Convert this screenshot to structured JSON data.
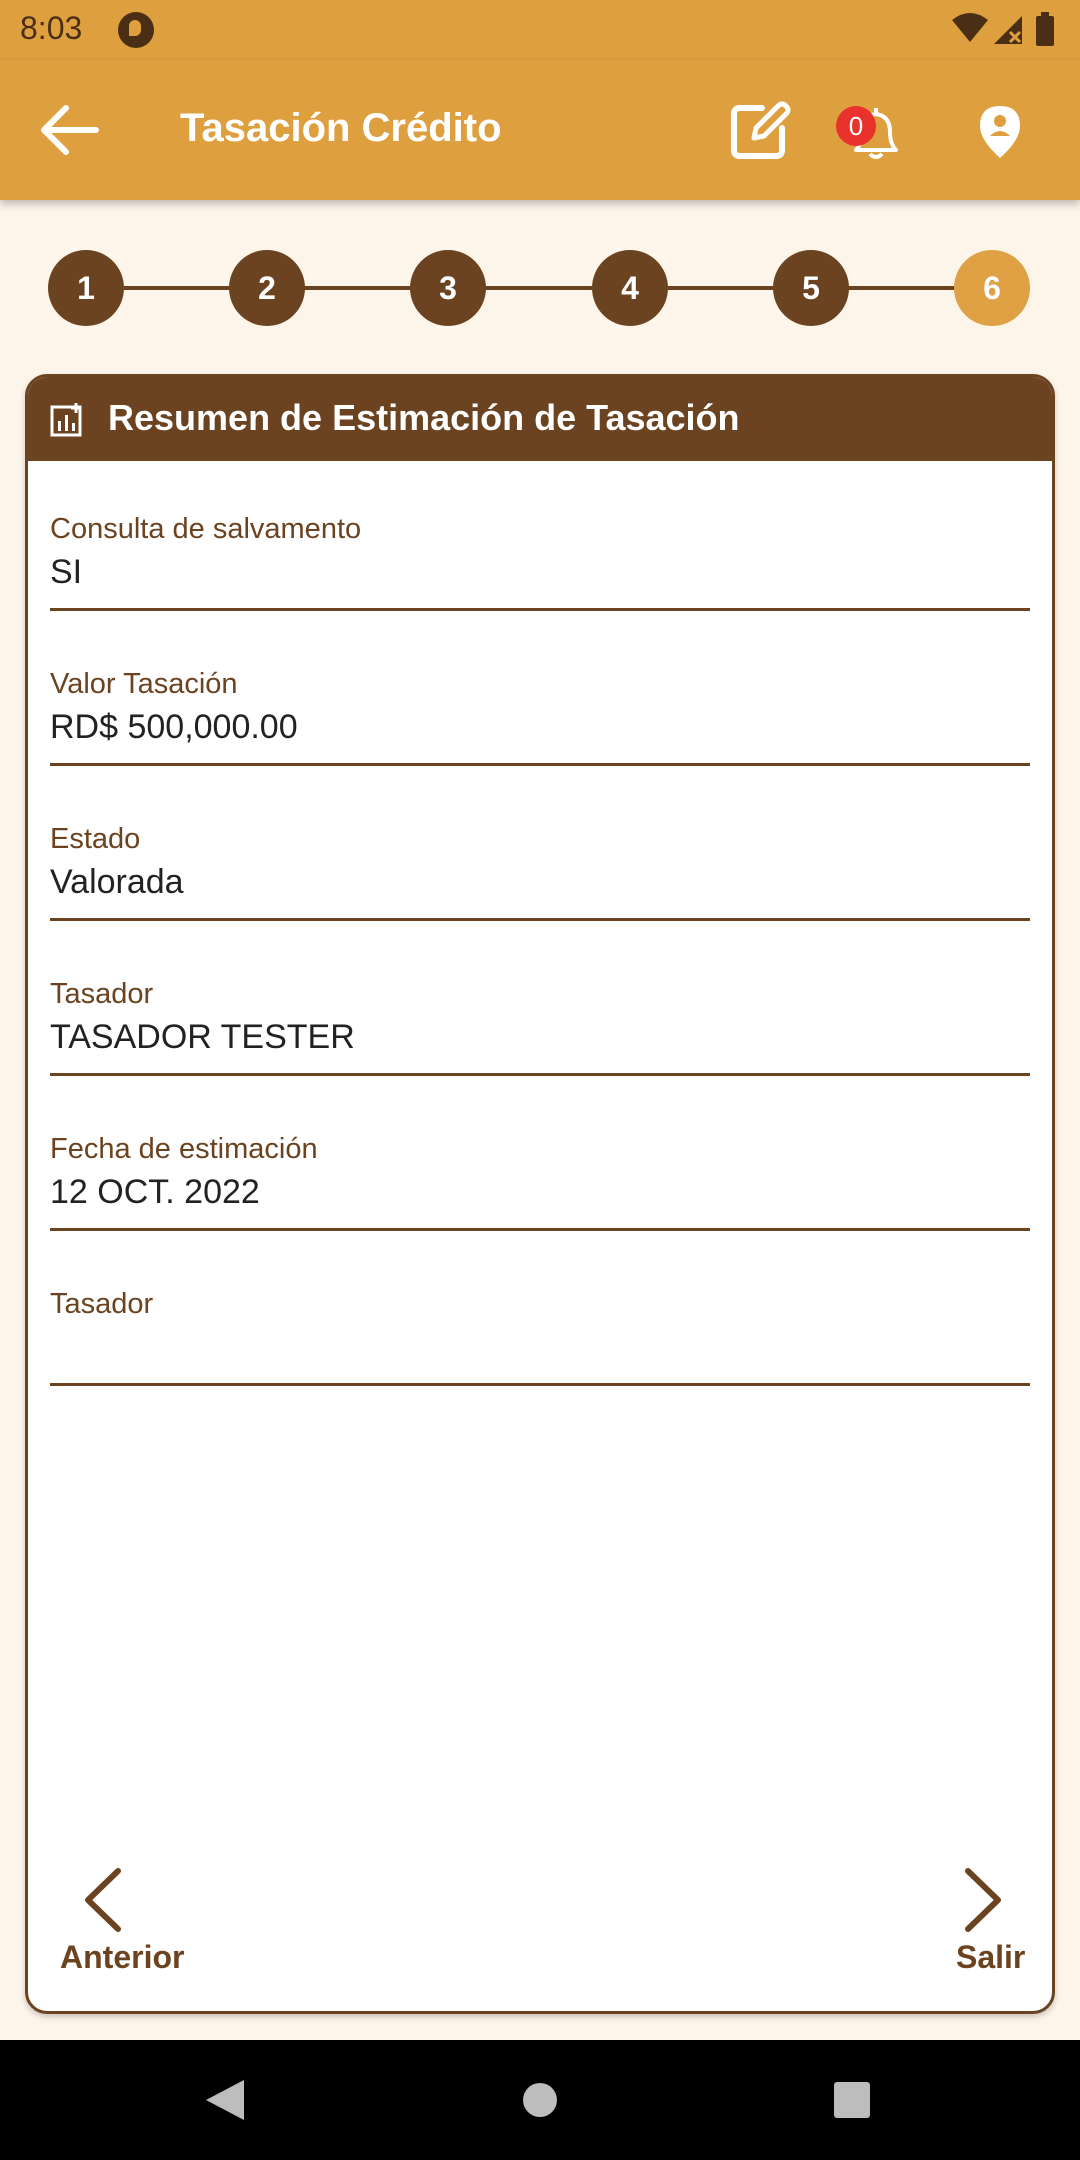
{
  "status_bar": {
    "time": "8:03"
  },
  "app_bar": {
    "title": "Tasación Crédito",
    "notification_count": "0"
  },
  "stepper": {
    "steps": [
      "1",
      "2",
      "3",
      "4",
      "5",
      "6"
    ],
    "active_step": "6"
  },
  "card": {
    "title": "Resumen de Estimación de Tasación",
    "fields": [
      {
        "label": "Consulta de salvamento",
        "value": "SI"
      },
      {
        "label": "Valor Tasación",
        "value": "RD$ 500,000.00"
      },
      {
        "label": "Estado",
        "value": "Valorada"
      },
      {
        "label": "Tasador",
        "value": "TASADOR TESTER"
      },
      {
        "label": "Fecha de estimación",
        "value": "12 OCT. 2022"
      },
      {
        "label": "Tasador",
        "value": ""
      }
    ]
  },
  "navigation": {
    "prev_label": "Anterior",
    "next_label": "Salir"
  },
  "colors": {
    "primary": "#de9f3f",
    "brown": "#6b4320",
    "background": "#fdf5ea",
    "badge": "#e8322b"
  }
}
